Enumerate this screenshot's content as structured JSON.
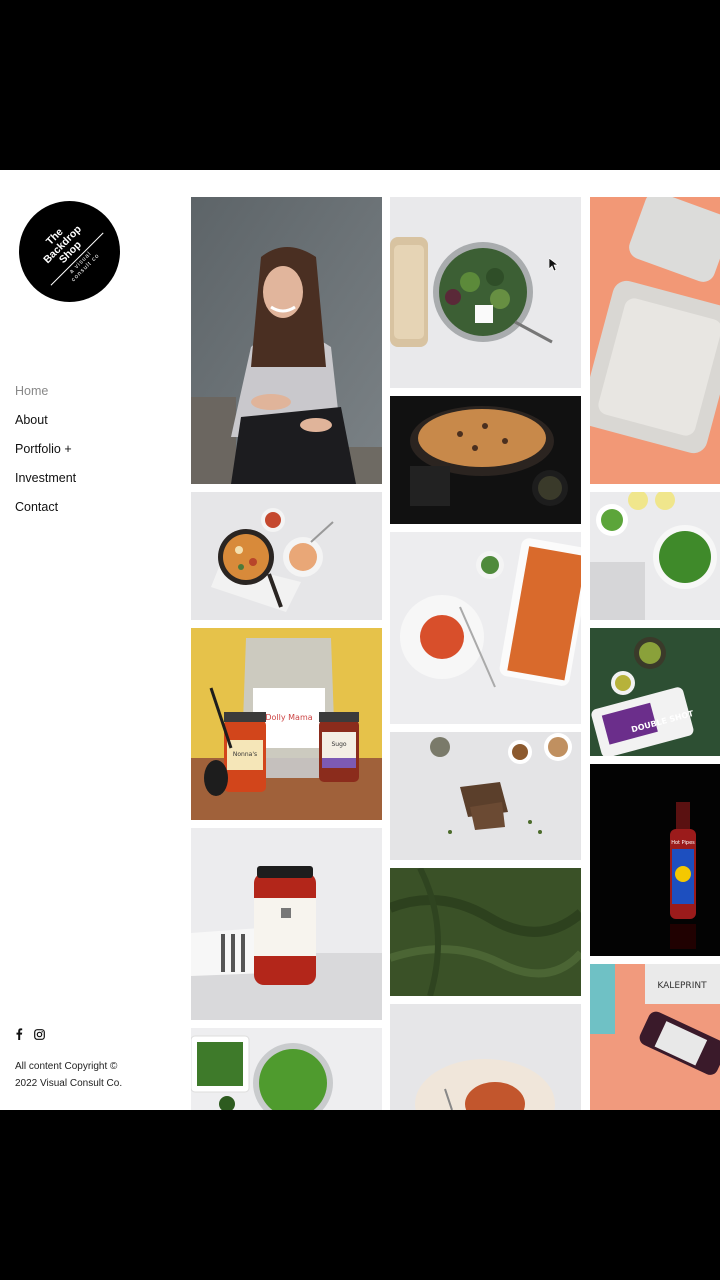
{
  "brand": {
    "logo_title_line1": "The",
    "logo_title_line2": "Backdrop",
    "logo_title_line3": "Shop",
    "logo_subtitle_line1": "a visual",
    "logo_subtitle_line2": "consult co"
  },
  "nav": {
    "items": [
      {
        "label": "Home"
      },
      {
        "label": "About"
      },
      {
        "label": "Portfolio +"
      },
      {
        "label": "Investment"
      },
      {
        "label": "Contact"
      }
    ],
    "active_index": 0
  },
  "social": {
    "icons": [
      "facebook-icon",
      "instagram-icon"
    ]
  },
  "footer": {
    "copyright_line1": "All content Copyright ©",
    "copyright_line2": "2022 Visual Consult Co."
  },
  "gallery": {
    "tiles": [
      {
        "name": "portrait-photo",
        "subject": "woman-portrait"
      },
      {
        "name": "salad-bowl-photo",
        "subject": "salad-bowl"
      },
      {
        "name": "takeaway-containers-photo",
        "subject": "containers-on-peach"
      },
      {
        "name": "focaccia-photo",
        "subject": "focaccia-dark"
      },
      {
        "name": "pasta-skillet-photo",
        "subject": "skillet-pasta"
      },
      {
        "name": "green-beans-photo",
        "subject": "green-beans-bowl"
      },
      {
        "name": "lasagne-photo",
        "subject": "lasagne-tray"
      },
      {
        "name": "sauce-jars-photo",
        "subject": "sauce-jars-yellow"
      },
      {
        "name": "pesto-packet-photo",
        "subject": "double-shot-packet"
      },
      {
        "name": "crackers-photo",
        "subject": "seed-crackers"
      },
      {
        "name": "hot-sauce-photo",
        "subject": "hot-sauce-bottle"
      },
      {
        "name": "sauce-jar-photo",
        "subject": "tomato-sauce-jar"
      },
      {
        "name": "green-fabric-photo",
        "subject": "green-backdrop"
      },
      {
        "name": "kaleprint-photo",
        "subject": "bottle-kaleprint"
      },
      {
        "name": "greens-photo",
        "subject": "greens-dishes"
      },
      {
        "name": "plated-pasta-photo",
        "subject": "pasta-plate"
      }
    ]
  },
  "labels": {
    "jar1_label": "Nonna's",
    "jar2_label": "Sugo",
    "bag_label": "Dolly Mama",
    "packet_brand": "DOUBLE SHOT",
    "hot_sauce_label": "Hot Pipes",
    "kaleprint_label": "KALEPRINT"
  },
  "colors": {
    "frame": "#000000",
    "page": "#ffffff",
    "nav_active": "#888888",
    "text": "#111111"
  }
}
